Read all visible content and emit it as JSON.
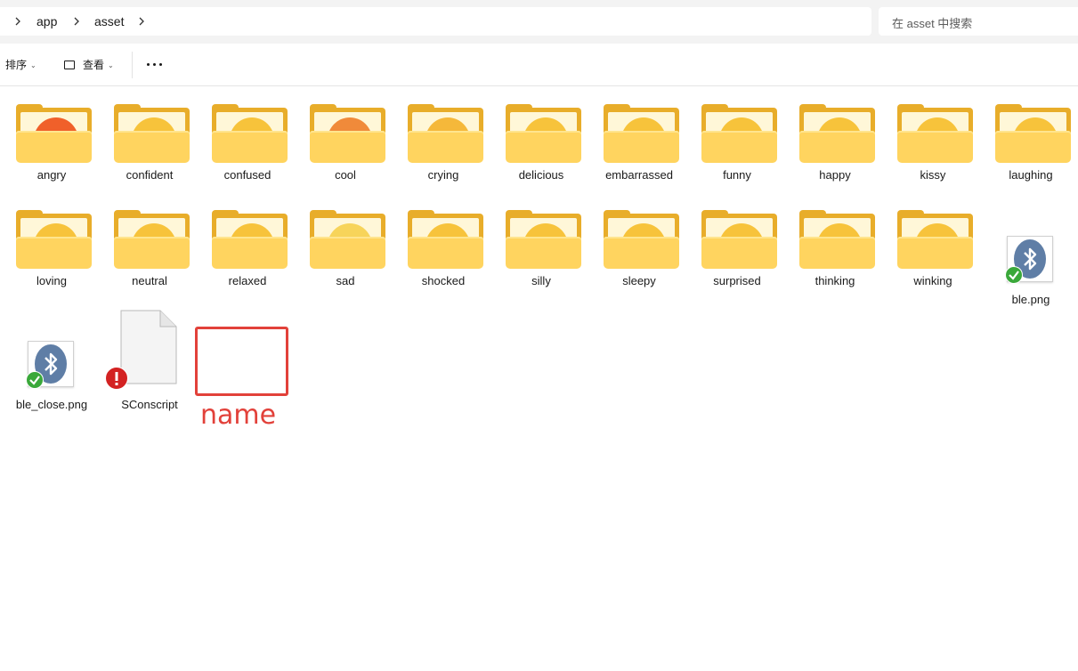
{
  "address": {
    "crumbs": [
      "app",
      "asset"
    ]
  },
  "search": {
    "placeholder": "在 asset 中搜索"
  },
  "toolbar": {
    "sort_label": "排序",
    "view_label": "查看",
    "more_icon": "more-icon"
  },
  "folders_row1": [
    {
      "name": "angry",
      "color": "#f0602a"
    },
    {
      "name": "confident",
      "color": "#f7c33b"
    },
    {
      "name": "confused",
      "color": "#f7c33b"
    },
    {
      "name": "cool",
      "color": "#f08a3a"
    },
    {
      "name": "crying",
      "color": "#f5b83a"
    },
    {
      "name": "delicious",
      "color": "#f7c33b"
    },
    {
      "name": "embarrassed",
      "color": "#f7c33b"
    },
    {
      "name": "funny",
      "color": "#f7c33b"
    },
    {
      "name": "happy",
      "color": "#f7c33b"
    },
    {
      "name": "kissy",
      "color": "#f7c33b"
    },
    {
      "name": "laughing",
      "color": "#f7c33b"
    }
  ],
  "folders_row2": [
    {
      "name": "loving",
      "color": "#f7c33b"
    },
    {
      "name": "neutral",
      "color": "#f7c33b"
    },
    {
      "name": "relaxed",
      "color": "#f7c33b"
    },
    {
      "name": "sad",
      "color": "#f7d45a"
    },
    {
      "name": "shocked",
      "color": "#f7c33b"
    },
    {
      "name": "silly",
      "color": "#f7c33b"
    },
    {
      "name": "sleepy",
      "color": "#f7c33b"
    },
    {
      "name": "surprised",
      "color": "#f7c33b"
    },
    {
      "name": "thinking",
      "color": "#f7c33b"
    },
    {
      "name": "winking",
      "color": "#f7c33b"
    }
  ],
  "files": {
    "ble": "ble.png",
    "ble_close": "ble_close.png",
    "script": "SConscript"
  },
  "annotation": {
    "label": "name",
    "color": "#e2413a"
  }
}
